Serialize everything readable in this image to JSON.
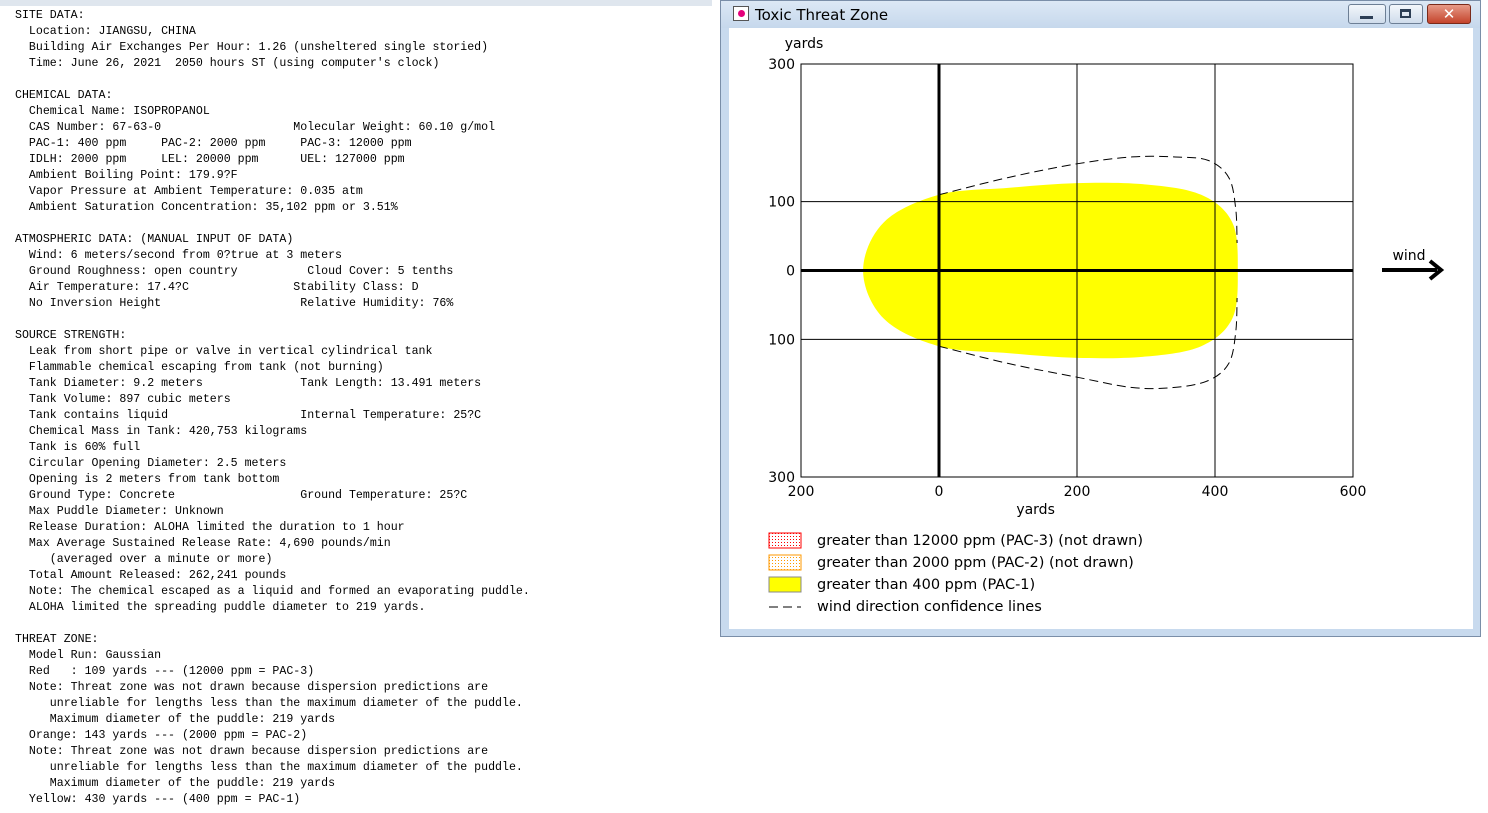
{
  "report": {
    "lines": [
      "SITE DATA:",
      "  Location: JIANGSU, CHINA",
      "  Building Air Exchanges Per Hour: 1.26 (unsheltered single storied)",
      "  Time: June 26, 2021  2050 hours ST (using computer's clock)",
      "",
      "CHEMICAL DATA:",
      "  Chemical Name: ISOPROPANOL",
      "  CAS Number: 67-63-0                   Molecular Weight: 60.10 g/mol",
      "  PAC-1: 400 ppm     PAC-2: 2000 ppm     PAC-3: 12000 ppm",
      "  IDLH: 2000 ppm     LEL: 20000 ppm      UEL: 127000 ppm",
      "  Ambient Boiling Point: 179.9?F",
      "  Vapor Pressure at Ambient Temperature: 0.035 atm",
      "  Ambient Saturation Concentration: 35,102 ppm or 3.51%",
      "",
      "ATMOSPHERIC DATA: (MANUAL INPUT OF DATA)",
      "  Wind: 6 meters/second from 0?true at 3 meters",
      "  Ground Roughness: open country          Cloud Cover: 5 tenths",
      "  Air Temperature: 17.4?C               Stability Class: D",
      "  No Inversion Height                    Relative Humidity: 76%",
      "",
      "SOURCE STRENGTH:",
      "  Leak from short pipe or valve in vertical cylindrical tank",
      "  Flammable chemical escaping from tank (not burning)",
      "  Tank Diameter: 9.2 meters              Tank Length: 13.491 meters",
      "  Tank Volume: 897 cubic meters",
      "  Tank contains liquid                   Internal Temperature: 25?C",
      "  Chemical Mass in Tank: 420,753 kilograms",
      "  Tank is 60% full",
      "  Circular Opening Diameter: 2.5 meters",
      "  Opening is 2 meters from tank bottom",
      "  Ground Type: Concrete                  Ground Temperature: 25?C",
      "  Max Puddle Diameter: Unknown",
      "  Release Duration: ALOHA limited the duration to 1 hour",
      "  Max Average Sustained Release Rate: 4,690 pounds/min",
      "     (averaged over a minute or more)",
      "  Total Amount Released: 262,241 pounds",
      "  Note: The chemical escaped as a liquid and formed an evaporating puddle.",
      "  ALOHA limited the spreading puddle diameter to 219 yards.",
      "",
      "THREAT ZONE:",
      "  Model Run: Gaussian",
      "  Red   : 109 yards --- (12000 ppm = PAC-3)",
      "  Note: Threat zone was not drawn because dispersion predictions are",
      "     unreliable for lengths less than the maximum diameter of the puddle.",
      "     Maximum diameter of the puddle: 219 yards",
      "  Orange: 143 yards --- (2000 ppm = PAC-2)",
      "  Note: Threat zone was not drawn because dispersion predictions are",
      "     unreliable for lengths less than the maximum diameter of the puddle.",
      "     Maximum diameter of the puddle: 219 yards",
      "  Yellow: 430 yards --- (400 ppm = PAC-1)"
    ]
  },
  "window": {
    "title": "Toxic Threat Zone",
    "close_glyph": "✕"
  },
  "chart_data": {
    "type": "area",
    "xlabel": "yards",
    "ylabel": "yards",
    "xlim": [
      -200,
      600
    ],
    "ylim": [
      -300,
      300
    ],
    "x_tick_labels": [
      "200",
      "0",
      "200",
      "400",
      "600"
    ],
    "y_tick_labels": [
      "300",
      "100",
      "0",
      "100",
      "300"
    ],
    "x_ticks": [
      -200,
      0,
      200,
      400,
      600
    ],
    "y_ticks": [
      300,
      100,
      0,
      -100,
      -300
    ],
    "wind_label": "wind",
    "grid": true,
    "zones": [
      {
        "name": "greater than 400 ppm (PAC-1)",
        "color": "#ffff00",
        "outline": [
          [
            -110,
            0
          ],
          [
            -80,
            70
          ],
          [
            0,
            110
          ],
          [
            100,
            120
          ],
          [
            200,
            127
          ],
          [
            300,
            125
          ],
          [
            380,
            110
          ],
          [
            425,
            70
          ],
          [
            433,
            0
          ],
          [
            425,
            -70
          ],
          [
            380,
            -110
          ],
          [
            300,
            -125
          ],
          [
            200,
            -127
          ],
          [
            100,
            -120
          ],
          [
            0,
            -110
          ],
          [
            -80,
            -70
          ]
        ]
      }
    ],
    "confidence_lines": {
      "upper": [
        [
          0,
          110
        ],
        [
          100,
          135
        ],
        [
          200,
          155
        ],
        [
          280,
          165
        ],
        [
          340,
          165
        ],
        [
          390,
          160
        ],
        [
          420,
          135
        ],
        [
          430,
          90
        ],
        [
          432,
          40
        ]
      ],
      "lower": [
        [
          0,
          -110
        ],
        [
          100,
          -135
        ],
        [
          200,
          -155
        ],
        [
          280,
          -170
        ],
        [
          340,
          -170
        ],
        [
          390,
          -160
        ],
        [
          420,
          -135
        ],
        [
          430,
          -90
        ],
        [
          432,
          -40
        ]
      ]
    },
    "legend": [
      {
        "label": "greater than 12000 ppm (PAC-3) (not drawn)",
        "swatch": "dotted-red",
        "color": "#ff0000"
      },
      {
        "label": "greater than 2000 ppm (PAC-2) (not drawn)",
        "swatch": "dotted-orange",
        "color": "#ff9900"
      },
      {
        "label": "greater than 400 ppm (PAC-1)",
        "swatch": "solid-yellow",
        "color": "#ffff00"
      },
      {
        "label": "wind direction confidence lines",
        "swatch": "dashed-line",
        "color": "#000000"
      }
    ]
  }
}
